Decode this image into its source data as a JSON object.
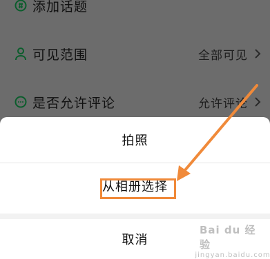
{
  "settings": {
    "items": [
      {
        "icon": "hashtag-circle-icon",
        "label": "添加话题",
        "value": ""
      },
      {
        "icon": "person-icon",
        "label": "可见范围",
        "value": "全部可见"
      },
      {
        "icon": "comment-bubble-icon",
        "label": "是否允许评论",
        "value": "允许评论"
      }
    ]
  },
  "action_sheet": {
    "take_photo": "拍照",
    "choose_from_album": "从相册选择",
    "cancel": "取消"
  },
  "annotation": {
    "color": "#f08a3a"
  },
  "watermark": {
    "main": "Bai du 经验",
    "sub": "jingyan.baidu.com"
  },
  "colors": {
    "accent": "#07c160"
  }
}
